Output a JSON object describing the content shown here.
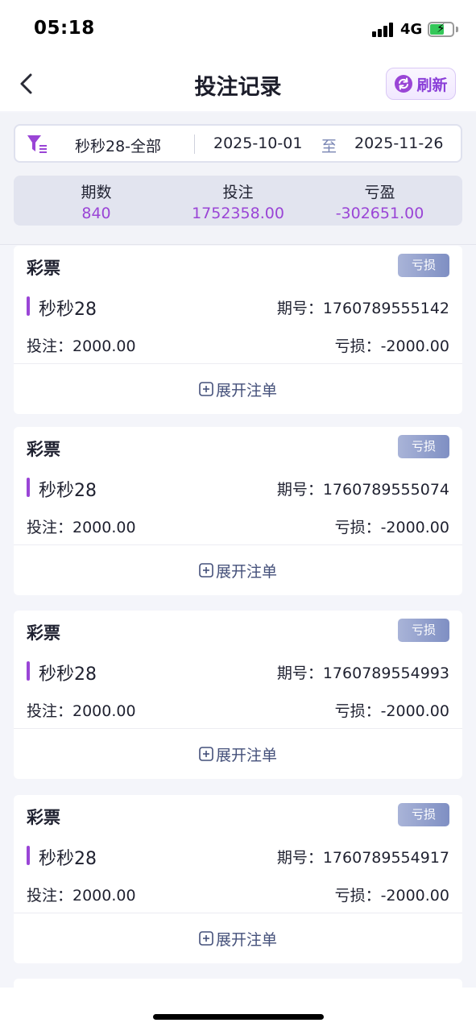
{
  "status_bar": {
    "time": "05:18",
    "network": "4G",
    "icons": [
      "signal-icon",
      "battery-charging-icon"
    ]
  },
  "header": {
    "title": "投注记录",
    "back_icon": "chevron-left-icon",
    "refresh_label": "刷新",
    "refresh_icon": "refresh-icon"
  },
  "filter": {
    "icon": "filter-icon",
    "game": "秒秒28-全部",
    "date_start": "2025-10-01",
    "date_separator": "至",
    "date_end": "2025-11-26"
  },
  "summary": {
    "periods_label": "期数",
    "periods_value": "840",
    "bet_label": "投注",
    "bet_value": "1752358.00",
    "pnl_label": "亏盈",
    "pnl_value": "-302651.00"
  },
  "records": [
    {
      "type": "彩票",
      "status": "亏损",
      "game": "秒秒28",
      "issue": "期号：1760789555142",
      "bet": "投注：2000.00",
      "loss": "亏损：-2000.00",
      "expand_label": "展开注单"
    },
    {
      "type": "彩票",
      "status": "亏损",
      "game": "秒秒28",
      "issue": "期号：1760789555074",
      "bet": "投注：2000.00",
      "loss": "亏损：-2000.00",
      "expand_label": "展开注单"
    },
    {
      "type": "彩票",
      "status": "亏损",
      "game": "秒秒28",
      "issue": "期号：1760789554993",
      "bet": "投注：2000.00",
      "loss": "亏损：-2000.00",
      "expand_label": "展开注单"
    },
    {
      "type": "彩票",
      "status": "亏损",
      "game": "秒秒28",
      "issue": "期号：1760789554917",
      "bet": "投注：2000.00",
      "loss": "亏损：-2000.00",
      "expand_label": "展开注单"
    }
  ],
  "colors": {
    "accent": "#9a45d6",
    "badge": "#8f9dcb",
    "background": "#f4f5fa"
  }
}
